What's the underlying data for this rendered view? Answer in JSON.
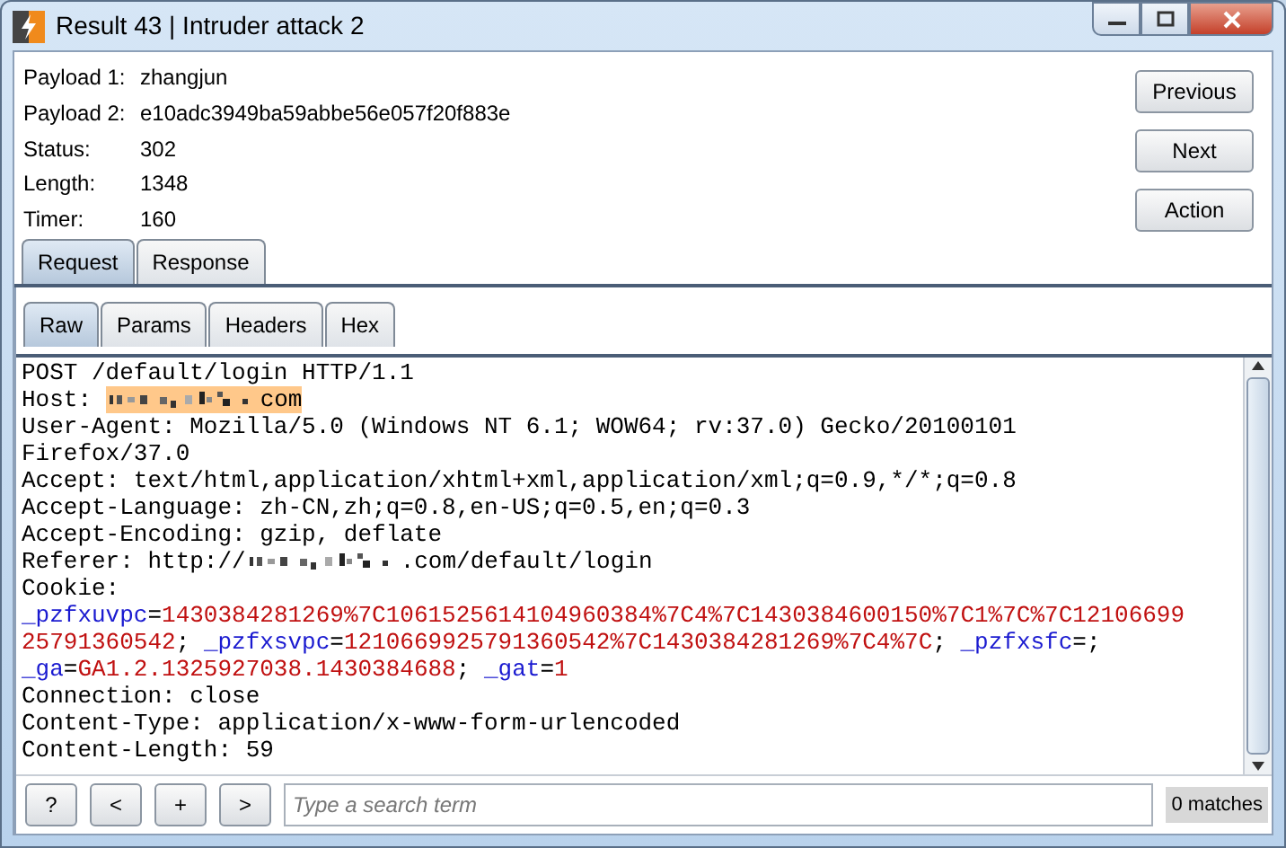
{
  "window": {
    "title": "Result 43 | Intruder attack 2"
  },
  "details": [
    {
      "label": "Payload 1:",
      "value": "zhangjun"
    },
    {
      "label": "Payload 2:",
      "value": "e10adc3949ba59abbe56e057f20f883e"
    },
    {
      "label": "Status:",
      "value": "302"
    },
    {
      "label": "Length:",
      "value": "1348"
    },
    {
      "label": "Timer:",
      "value": "160"
    }
  ],
  "side_buttons": [
    "Previous",
    "Next",
    "Action"
  ],
  "tabs": [
    {
      "label": "Request",
      "selected": true
    },
    {
      "label": "Response",
      "selected": false
    }
  ],
  "subtabs": [
    {
      "label": "Raw",
      "selected": true
    },
    {
      "label": "Params",
      "selected": false
    },
    {
      "label": "Headers",
      "selected": false
    },
    {
      "label": "Hex",
      "selected": false
    }
  ],
  "request_lines": [
    [
      {
        "kind": "plain",
        "text": "POST /default/login HTTP/1.1"
      }
    ],
    [
      {
        "kind": "plain",
        "text": "Host: "
      },
      {
        "kind": "redacted",
        "highlight": true
      },
      {
        "kind": "plain",
        "text": "com",
        "highlight": true
      }
    ],
    [
      {
        "kind": "plain",
        "text": "User-Agent: Mozilla/5.0 (Windows NT 6.1; WOW64; rv:37.0) Gecko/20100101"
      }
    ],
    [
      {
        "kind": "plain",
        "text": "Firefox/37.0"
      }
    ],
    [
      {
        "kind": "plain",
        "text": "Accept: text/html,application/xhtml+xml,application/xml;q=0.9,*/*;q=0.8"
      }
    ],
    [
      {
        "kind": "plain",
        "text": "Accept-Language: zh-CN,zh;q=0.8,en-US;q=0.5,en;q=0.3"
      }
    ],
    [
      {
        "kind": "plain",
        "text": "Accept-Encoding: gzip, deflate"
      }
    ],
    [
      {
        "kind": "plain",
        "text": "Referer: http://"
      },
      {
        "kind": "redacted"
      },
      {
        "kind": "plain",
        "text": ".com/default/login"
      }
    ],
    [
      {
        "kind": "plain",
        "text": "Cookie:"
      }
    ],
    [
      {
        "kind": "name",
        "text": "_pzfxuvpc"
      },
      {
        "kind": "plain",
        "text": "="
      },
      {
        "kind": "value",
        "text": "1430384281269%7C1061525614104960384%7C4%7C1430384600150%7C1%7C%7C12106699"
      }
    ],
    [
      {
        "kind": "value",
        "text": "25791360542"
      },
      {
        "kind": "plain",
        "text": "; "
      },
      {
        "kind": "name",
        "text": "_pzfxsvpc"
      },
      {
        "kind": "plain",
        "text": "="
      },
      {
        "kind": "value",
        "text": "1210669925791360542%7C1430384281269%7C4%7C"
      },
      {
        "kind": "plain",
        "text": "; "
      },
      {
        "kind": "name",
        "text": "_pzfxsfc"
      },
      {
        "kind": "plain",
        "text": "=;"
      }
    ],
    [
      {
        "kind": "name",
        "text": "_ga"
      },
      {
        "kind": "plain",
        "text": "="
      },
      {
        "kind": "value",
        "text": "GA1.2.1325927038.1430384688"
      },
      {
        "kind": "plain",
        "text": "; "
      },
      {
        "kind": "name",
        "text": "_gat"
      },
      {
        "kind": "plain",
        "text": "="
      },
      {
        "kind": "value",
        "text": "1"
      }
    ],
    [
      {
        "kind": "plain",
        "text": "Connection: close"
      }
    ],
    [
      {
        "kind": "plain",
        "text": "Content-Type: application/x-www-form-urlencoded"
      }
    ],
    [
      {
        "kind": "plain",
        "text": "Content-Length: 59"
      }
    ]
  ],
  "bottom_bar": {
    "buttons": [
      "?",
      "<",
      "+",
      ">"
    ],
    "search": {
      "placeholder": "Type a search term"
    },
    "matches": "0 matches"
  }
}
